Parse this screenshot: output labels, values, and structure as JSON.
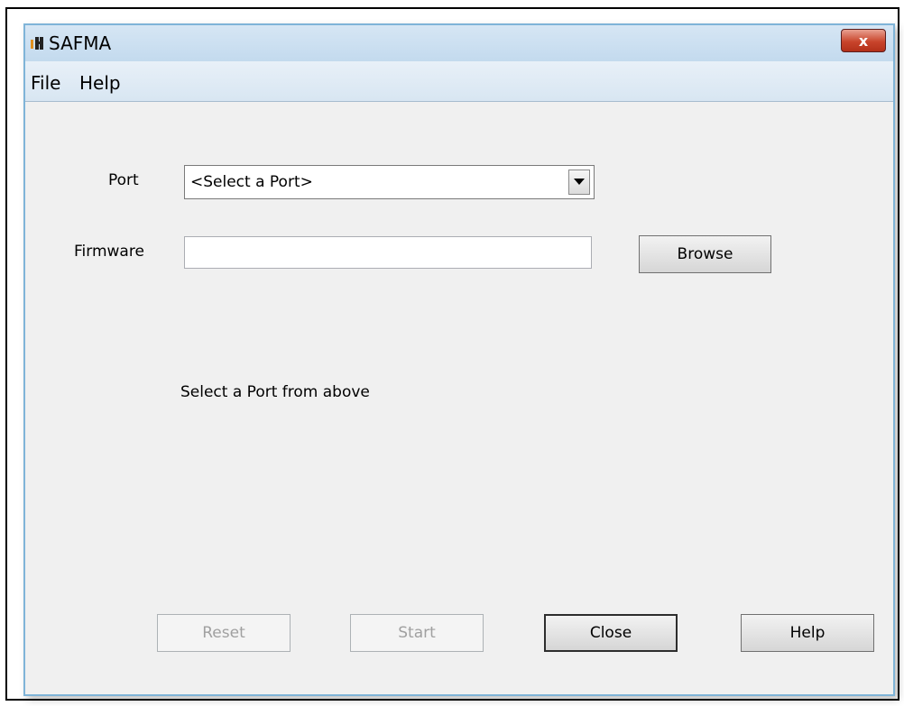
{
  "window": {
    "title": "SAFMA",
    "icon": "app-icon",
    "close_symbol": "x"
  },
  "menu": {
    "items": [
      "File",
      "Help"
    ]
  },
  "form": {
    "port_label": "Port",
    "port_selected": "<Select a Port>",
    "firmware_label": "Firmware",
    "firmware_value": "",
    "browse_label": "Browse"
  },
  "status_text": "Select a Port from above",
  "buttons": {
    "reset": {
      "label": "Reset",
      "enabled": false
    },
    "start": {
      "label": "Start",
      "enabled": false
    },
    "close": {
      "label": "Close",
      "enabled": true
    },
    "help": {
      "label": "Help",
      "enabled": true
    }
  },
  "colors": {
    "window_border": "#7fb4d8",
    "close_button": "#c9452c"
  }
}
